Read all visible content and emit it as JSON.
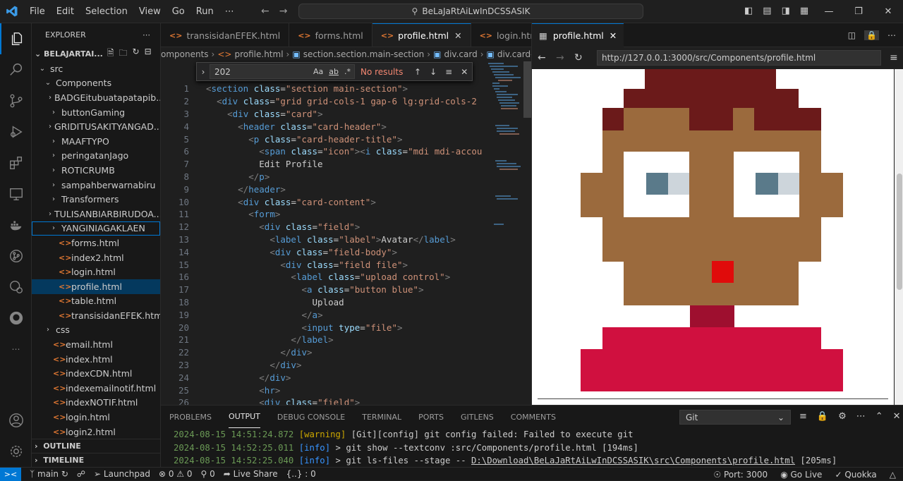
{
  "titlebar": {
    "menu": [
      "File",
      "Edit",
      "Selection",
      "View",
      "Go",
      "Run",
      "⋯"
    ],
    "command_center": "BeLaJaRtAiLwInDCSSASIK"
  },
  "explorer": {
    "header": "EXPLORER",
    "folder": "BELAJARTAI...",
    "tree": [
      {
        "label": "src",
        "depth": 0,
        "kind": "folder-open"
      },
      {
        "label": "Components",
        "depth": 1,
        "kind": "folder-open"
      },
      {
        "label": "BADGEitubuatapatapib...",
        "depth": 2,
        "kind": "folder"
      },
      {
        "label": "buttonGaming",
        "depth": 2,
        "kind": "folder"
      },
      {
        "label": "GRIDITUSAKITYANGAD...",
        "depth": 2,
        "kind": "folder"
      },
      {
        "label": "MAAFTYPO",
        "depth": 2,
        "kind": "folder"
      },
      {
        "label": "peringatanJago",
        "depth": 2,
        "kind": "folder"
      },
      {
        "label": "ROTICRUMB",
        "depth": 2,
        "kind": "folder"
      },
      {
        "label": "sampahberwarnabiru",
        "depth": 2,
        "kind": "folder"
      },
      {
        "label": "Transformers",
        "depth": 2,
        "kind": "folder"
      },
      {
        "label": "TULISANBIARBIRUDOA...",
        "depth": 2,
        "kind": "folder"
      },
      {
        "label": "YANGINIAGAKLAEN",
        "depth": 2,
        "kind": "folder",
        "focused": true
      },
      {
        "label": "forms.html",
        "depth": 2,
        "kind": "html"
      },
      {
        "label": "index2.html",
        "depth": 2,
        "kind": "html"
      },
      {
        "label": "login.html",
        "depth": 2,
        "kind": "html"
      },
      {
        "label": "profile.html",
        "depth": 2,
        "kind": "html",
        "selected": true
      },
      {
        "label": "table.html",
        "depth": 2,
        "kind": "html"
      },
      {
        "label": "transisidanEFEK.html",
        "depth": 2,
        "kind": "html"
      },
      {
        "label": "css",
        "depth": 1,
        "kind": "folder"
      },
      {
        "label": "email.html",
        "depth": 1,
        "kind": "html"
      },
      {
        "label": "index.html",
        "depth": 1,
        "kind": "html"
      },
      {
        "label": "indexCDN.html",
        "depth": 1,
        "kind": "html"
      },
      {
        "label": "indexemailnotif.html",
        "depth": 1,
        "kind": "html"
      },
      {
        "label": "indexNOTIF.html",
        "depth": 1,
        "kind": "html"
      },
      {
        "label": "login.html",
        "depth": 1,
        "kind": "html"
      },
      {
        "label": "login2.html",
        "depth": 1,
        "kind": "html"
      }
    ],
    "outline": "OUTLINE",
    "timeline": "TIMELINE"
  },
  "editor": {
    "tabs": [
      {
        "label": "transisidanEFEK.html",
        "active": false
      },
      {
        "label": "forms.html",
        "active": false
      },
      {
        "label": "profile.html",
        "active": true
      },
      {
        "label": "login.html",
        "active": false
      }
    ],
    "breadcrumbs": [
      "omponents",
      "profile.html",
      "section.section.main-section",
      "div.card",
      "div.card-content"
    ],
    "find": {
      "query": "202",
      "result": "No results",
      "aa": "Aa",
      "ab": "ab",
      "regex": ".*"
    },
    "lines": [
      {
        "n": "1",
        "indent": "",
        "parts": [
          [
            "br",
            "<"
          ],
          [
            "tg",
            "section"
          ],
          [
            "tx",
            " "
          ],
          [
            "at",
            "class"
          ],
          [
            "tx",
            "="
          ],
          [
            "st",
            "\"section main-section\""
          ],
          [
            "br",
            ">"
          ]
        ]
      },
      {
        "n": "2",
        "indent": "  ",
        "parts": [
          [
            "br",
            "<"
          ],
          [
            "tg",
            "div"
          ],
          [
            "tx",
            " "
          ],
          [
            "at",
            "class"
          ],
          [
            "tx",
            "="
          ],
          [
            "st",
            "\"grid grid-cols-1 gap-6 lg:grid-cols-2"
          ]
        ]
      },
      {
        "n": "3",
        "indent": "    ",
        "parts": [
          [
            "br",
            "<"
          ],
          [
            "tg",
            "div"
          ],
          [
            "tx",
            " "
          ],
          [
            "at",
            "class"
          ],
          [
            "tx",
            "="
          ],
          [
            "st",
            "\"card\""
          ],
          [
            "br",
            ">"
          ]
        ]
      },
      {
        "n": "4",
        "indent": "      ",
        "parts": [
          [
            "br",
            "<"
          ],
          [
            "tg",
            "header"
          ],
          [
            "tx",
            " "
          ],
          [
            "at",
            "class"
          ],
          [
            "tx",
            "="
          ],
          [
            "st",
            "\"card-header\""
          ],
          [
            "br",
            ">"
          ]
        ]
      },
      {
        "n": "5",
        "indent": "        ",
        "parts": [
          [
            "br",
            "<"
          ],
          [
            "tg",
            "p"
          ],
          [
            "tx",
            " "
          ],
          [
            "at",
            "class"
          ],
          [
            "tx",
            "="
          ],
          [
            "st",
            "\"card-header-title\""
          ],
          [
            "br",
            ">"
          ]
        ]
      },
      {
        "n": "6",
        "indent": "          ",
        "parts": [
          [
            "br",
            "<"
          ],
          [
            "tg",
            "span"
          ],
          [
            "tx",
            " "
          ],
          [
            "at",
            "class"
          ],
          [
            "tx",
            "="
          ],
          [
            "st",
            "\"icon\""
          ],
          [
            "br",
            "><"
          ],
          [
            "tg",
            "i"
          ],
          [
            "tx",
            " "
          ],
          [
            "at",
            "class"
          ],
          [
            "tx",
            "="
          ],
          [
            "st",
            "\"mdi mdi-accou"
          ]
        ]
      },
      {
        "n": "7",
        "indent": "          ",
        "parts": [
          [
            "tx",
            "Edit Profile"
          ]
        ]
      },
      {
        "n": "8",
        "indent": "        ",
        "parts": [
          [
            "br",
            "</"
          ],
          [
            "tg",
            "p"
          ],
          [
            "br",
            ">"
          ]
        ]
      },
      {
        "n": "9",
        "indent": "      ",
        "parts": [
          [
            "br",
            "</"
          ],
          [
            "tg",
            "header"
          ],
          [
            "br",
            ">"
          ]
        ]
      },
      {
        "n": "10",
        "indent": "      ",
        "parts": [
          [
            "br",
            "<"
          ],
          [
            "tg",
            "div"
          ],
          [
            "tx",
            " "
          ],
          [
            "at",
            "class"
          ],
          [
            "tx",
            "="
          ],
          [
            "st",
            "\"card-content\""
          ],
          [
            "br",
            ">"
          ]
        ]
      },
      {
        "n": "11",
        "indent": "        ",
        "parts": [
          [
            "br",
            "<"
          ],
          [
            "tg",
            "form"
          ],
          [
            "br",
            ">"
          ]
        ]
      },
      {
        "n": "12",
        "indent": "          ",
        "parts": [
          [
            "br",
            "<"
          ],
          [
            "tg",
            "div"
          ],
          [
            "tx",
            " "
          ],
          [
            "at",
            "class"
          ],
          [
            "tx",
            "="
          ],
          [
            "st",
            "\"field\""
          ],
          [
            "br",
            ">"
          ]
        ]
      },
      {
        "n": "13",
        "indent": "            ",
        "parts": [
          [
            "br",
            "<"
          ],
          [
            "tg",
            "label"
          ],
          [
            "tx",
            " "
          ],
          [
            "at",
            "class"
          ],
          [
            "tx",
            "="
          ],
          [
            "st",
            "\"label\""
          ],
          [
            "br",
            ">"
          ],
          [
            "tx",
            "Avatar"
          ],
          [
            "br",
            "</"
          ],
          [
            "tg",
            "label"
          ],
          [
            "br",
            ">"
          ]
        ]
      },
      {
        "n": "14",
        "indent": "            ",
        "parts": [
          [
            "br",
            "<"
          ],
          [
            "tg",
            "div"
          ],
          [
            "tx",
            " "
          ],
          [
            "at",
            "class"
          ],
          [
            "tx",
            "="
          ],
          [
            "st",
            "\"field-body\""
          ],
          [
            "br",
            ">"
          ]
        ]
      },
      {
        "n": "15",
        "indent": "              ",
        "parts": [
          [
            "br",
            "<"
          ],
          [
            "tg",
            "div"
          ],
          [
            "tx",
            " "
          ],
          [
            "at",
            "class"
          ],
          [
            "tx",
            "="
          ],
          [
            "st",
            "\"field file\""
          ],
          [
            "br",
            ">"
          ]
        ]
      },
      {
        "n": "16",
        "indent": "                ",
        "parts": [
          [
            "br",
            "<"
          ],
          [
            "tg",
            "label"
          ],
          [
            "tx",
            " "
          ],
          [
            "at",
            "class"
          ],
          [
            "tx",
            "="
          ],
          [
            "st",
            "\"upload control\""
          ],
          [
            "br",
            ">"
          ]
        ]
      },
      {
        "n": "17",
        "indent": "                  ",
        "parts": [
          [
            "br",
            "<"
          ],
          [
            "tg",
            "a"
          ],
          [
            "tx",
            " "
          ],
          [
            "at",
            "class"
          ],
          [
            "tx",
            "="
          ],
          [
            "st",
            "\"button blue\""
          ],
          [
            "br",
            ">"
          ]
        ]
      },
      {
        "n": "18",
        "indent": "                    ",
        "parts": [
          [
            "tx",
            "Upload"
          ]
        ]
      },
      {
        "n": "19",
        "indent": "                  ",
        "parts": [
          [
            "br",
            "</"
          ],
          [
            "tg",
            "a"
          ],
          [
            "br",
            ">"
          ]
        ]
      },
      {
        "n": "20",
        "indent": "                  ",
        "parts": [
          [
            "br",
            "<"
          ],
          [
            "tg",
            "input"
          ],
          [
            "tx",
            " "
          ],
          [
            "at",
            "type"
          ],
          [
            "tx",
            "="
          ],
          [
            "st",
            "\"file\""
          ],
          [
            "br",
            ">"
          ]
        ]
      },
      {
        "n": "21",
        "indent": "                ",
        "parts": [
          [
            "br",
            "</"
          ],
          [
            "tg",
            "label"
          ],
          [
            "br",
            ">"
          ]
        ]
      },
      {
        "n": "22",
        "indent": "              ",
        "parts": [
          [
            "br",
            "</"
          ],
          [
            "tg",
            "div"
          ],
          [
            "br",
            ">"
          ]
        ]
      },
      {
        "n": "23",
        "indent": "            ",
        "parts": [
          [
            "br",
            "</"
          ],
          [
            "tg",
            "div"
          ],
          [
            "br",
            ">"
          ]
        ]
      },
      {
        "n": "24",
        "indent": "          ",
        "parts": [
          [
            "br",
            "</"
          ],
          [
            "tg",
            "div"
          ],
          [
            "br",
            ">"
          ]
        ]
      },
      {
        "n": "25",
        "indent": "          ",
        "parts": [
          [
            "br",
            "<"
          ],
          [
            "tg",
            "hr"
          ],
          [
            "br",
            ">"
          ]
        ]
      },
      {
        "n": "26",
        "indent": "          ",
        "parts": [
          [
            "br",
            "<"
          ],
          [
            "tg",
            "div"
          ],
          [
            "tx",
            " "
          ],
          [
            "at",
            "class"
          ],
          [
            "tx",
            "="
          ],
          [
            "st",
            "\"field\""
          ],
          [
            "br",
            ">"
          ]
        ]
      }
    ]
  },
  "preview": {
    "tab_label": "profile.html",
    "url": "http://127.0.0.1:3000/src/Components/profile.html",
    "palette": {
      "hair": "#6b1a1a",
      "skin": "#9b6a3d",
      "eye_white": "#ffffff",
      "iris": "#5a7a8a",
      "eye_light": "#cdd5db",
      "nose": "#e00b0b",
      "neck": "#9e0f2f",
      "shirt": "#d0103f"
    }
  },
  "panel": {
    "tabs": [
      "PROBLEMS",
      "OUTPUT",
      "DEBUG CONSOLE",
      "TERMINAL",
      "PORTS",
      "GITLENS",
      "COMMENTS"
    ],
    "active_tab": "OUTPUT",
    "channel": "Git",
    "log": [
      {
        "ts": "2024-08-15 14:51:24.872",
        "level": "[warning]",
        "msg": " [Git][config] git config failed: Failed to execute git"
      },
      {
        "ts": "2024-08-15 14:52:25.011",
        "level": "[info]",
        "msg": " > git show --textconv :src/Components/profile.html [194ms]"
      },
      {
        "ts": "2024-08-15 14:52:25.040",
        "level": "[info]",
        "msg": " > git ls-files --stage -- ",
        "path": "D:\\Download\\BeLaJaRtAiLwInDCSSASIK\\src\\Components\\profile.html",
        "tail": " [205ms]"
      }
    ]
  },
  "statusbar": {
    "branch": "main",
    "launchpad": "Launchpad",
    "problems": "⊗ 0 ⚠ 0",
    "ports": "0",
    "liveshare": "Live Share",
    "braces": "{..} : 0",
    "port": "Port: 3000",
    "golive": "Go Live",
    "quokka": "Quokka"
  }
}
